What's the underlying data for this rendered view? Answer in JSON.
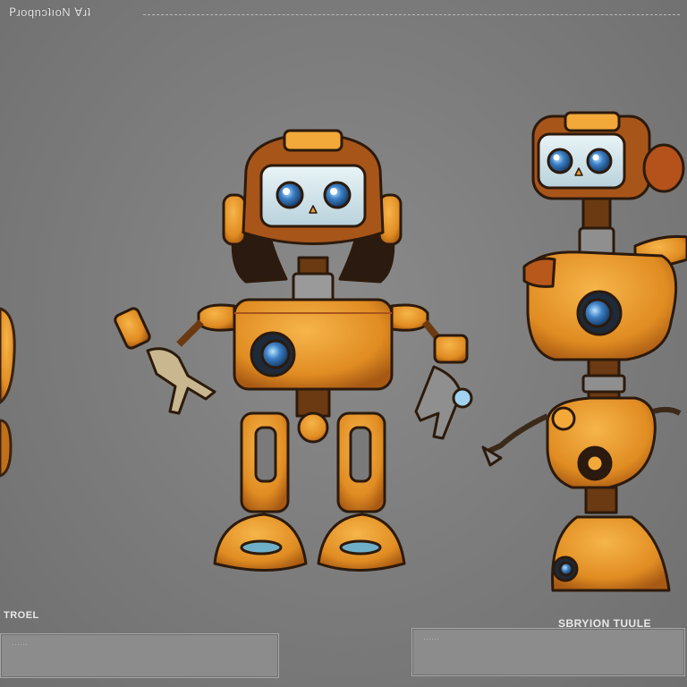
{
  "header": {
    "title": "ꓑɹoqnɔʇıoN ∀ɹʇ"
  },
  "labels": {
    "left": "TROEL",
    "right": "SBRYION TUULE"
  },
  "text_boxes": {
    "left_placeholder": "······",
    "right_placeholder": "······"
  },
  "colors": {
    "background": "#7d7d7d",
    "robot_body": "#e89a2c",
    "robot_shadow": "#b86a16",
    "robot_dark": "#6b3a12",
    "eye_blue": "#3b7fc4",
    "screen": "#d7e7ee"
  },
  "illustration": {
    "subject": "robot character turnaround sheet",
    "views": [
      "partial side view (left edge)",
      "front view",
      "side view"
    ]
  }
}
